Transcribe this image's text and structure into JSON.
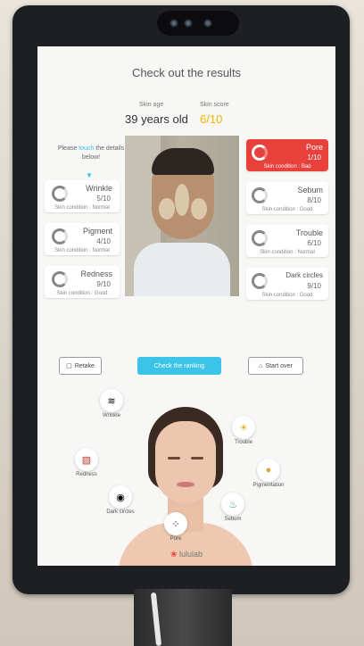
{
  "screen": {
    "title": "Check out the results",
    "skin_age_label": "Skin age",
    "skin_age_value": "39 years old",
    "skin_score_label": "Skin score",
    "skin_score_value": "6/10",
    "prompt_before": "Please ",
    "prompt_highlight": "touch",
    "prompt_after": " the details below!"
  },
  "left_cards": [
    {
      "name": "Wrinkle",
      "score": "5/10",
      "condition": "Skin condition : Normal"
    },
    {
      "name": "Pigment",
      "score": "4/10",
      "condition": "Skin condition : Normal"
    },
    {
      "name": "Redness",
      "score": "9/10",
      "condition": "Skin condition : Good"
    }
  ],
  "right_cards": [
    {
      "name": "Pore",
      "score": "1/10",
      "condition": "Skin condition : Bad",
      "active": true
    },
    {
      "name": "Sebum",
      "score": "8/10",
      "condition": "Skin condition : Good"
    },
    {
      "name": "Trouble",
      "score": "6/10",
      "condition": "Skin condition : Normal"
    },
    {
      "name": "Dark circles",
      "score": "9/10",
      "condition": "Skin condition : Good"
    }
  ],
  "buttons": {
    "retake": "Retake",
    "ranking": "Check the ranking",
    "start_over": "Start over"
  },
  "features": {
    "wrinkle": "Wrinkle",
    "redness": "Redness",
    "dark_circles": "Dark circles",
    "pore": "Pore",
    "sebum": "Sebum",
    "pigmentation": "Pigmentation",
    "trouble": "Trouble"
  },
  "brand": {
    "logo_text": "lululab"
  },
  "colors": {
    "accent": "#3cc3ea",
    "alert": "#e8413c",
    "score": "#f4b400"
  }
}
